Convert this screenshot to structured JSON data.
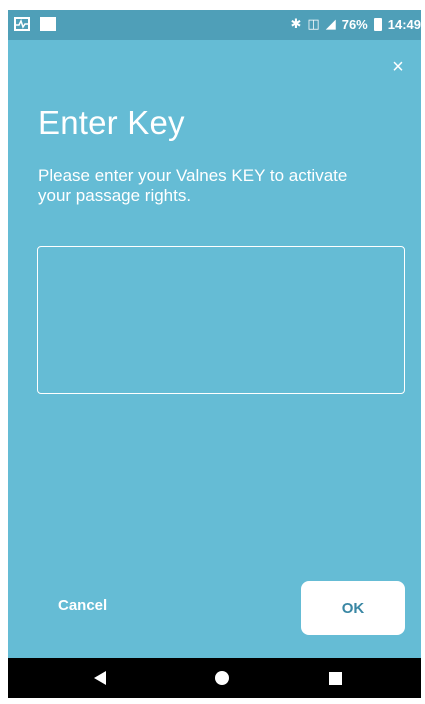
{
  "status_bar": {
    "battery_percent": "76%",
    "time": "14:49",
    "icons": [
      "activity-icon",
      "image-icon",
      "bluetooth-icon",
      "vibrate-icon",
      "signal-icon",
      "battery-icon"
    ]
  },
  "dialog": {
    "title": "Enter Key",
    "description": "Please enter your Valnes KEY to activate your passage rights.",
    "key_input": {
      "value": "",
      "placeholder": ""
    },
    "cancel_label": "Cancel",
    "ok_label": "OK",
    "close_glyph": "×"
  },
  "colors": {
    "background": "#65bcd5",
    "status_bar": "#4f9fb8",
    "ok_text": "#3a87a4"
  }
}
